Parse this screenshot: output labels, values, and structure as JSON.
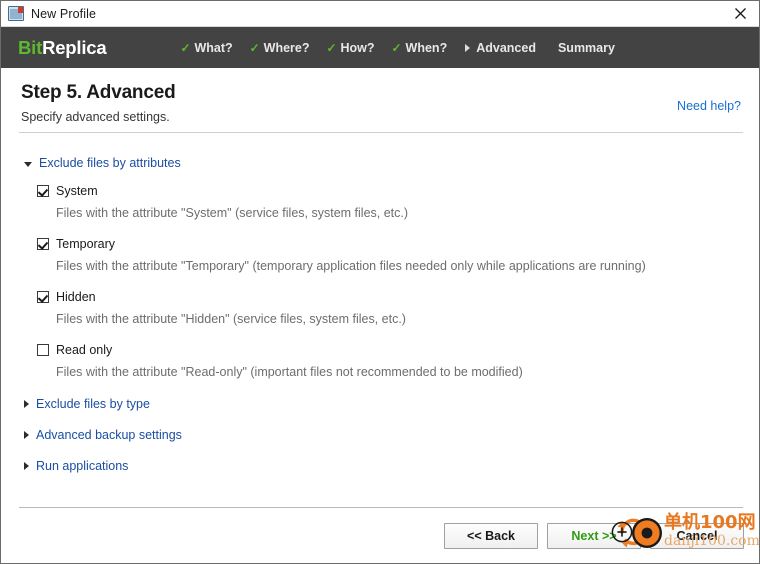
{
  "window": {
    "title": "New Profile",
    "icon": "profile-window-icon",
    "close_label": "✕"
  },
  "header": {
    "logo": {
      "first": "Bit",
      "second": "Replica",
      "accent_color": "#5cb82f"
    },
    "nav": [
      {
        "label": "What?",
        "marker": "check"
      },
      {
        "label": "Where?",
        "marker": "check"
      },
      {
        "label": "How?",
        "marker": "check"
      },
      {
        "label": "When?",
        "marker": "check"
      },
      {
        "label": "Advanced",
        "marker": "arrow"
      },
      {
        "label": "Summary",
        "marker": "none"
      }
    ]
  },
  "page": {
    "title": "Step 5. Advanced",
    "subtitle": "Specify advanced settings.",
    "need_help": "Need help?"
  },
  "sections": {
    "attributes": {
      "label": "Exclude files by attributes",
      "expanded": true,
      "items": [
        {
          "name": "System",
          "checked": true,
          "description": "Files with the attribute \"System\" (service files, system files, etc.)"
        },
        {
          "name": "Temporary",
          "checked": true,
          "description": "Files with the attribute \"Temporary\" (temporary application files needed only while applications are running)"
        },
        {
          "name": "Hidden",
          "checked": true,
          "description": "Files with the attribute \"Hidden\" (service files, system files, etc.)"
        },
        {
          "name": "Read only",
          "checked": false,
          "description": "Files with the attribute \"Read-only\" (important files not recommended to be modified)"
        }
      ]
    },
    "collapsed": [
      {
        "label": "Exclude files by type",
        "expanded": false
      },
      {
        "label": "Advanced backup settings",
        "expanded": false
      },
      {
        "label": "Run applications",
        "expanded": false
      }
    ]
  },
  "footer": {
    "back_label": "<< Back",
    "next_label": "Next >>",
    "cancel_label": "Cancel"
  },
  "watermark": {
    "cn_text": "单机100网",
    "en_text": "danji100.com",
    "color": "#e8781f"
  }
}
